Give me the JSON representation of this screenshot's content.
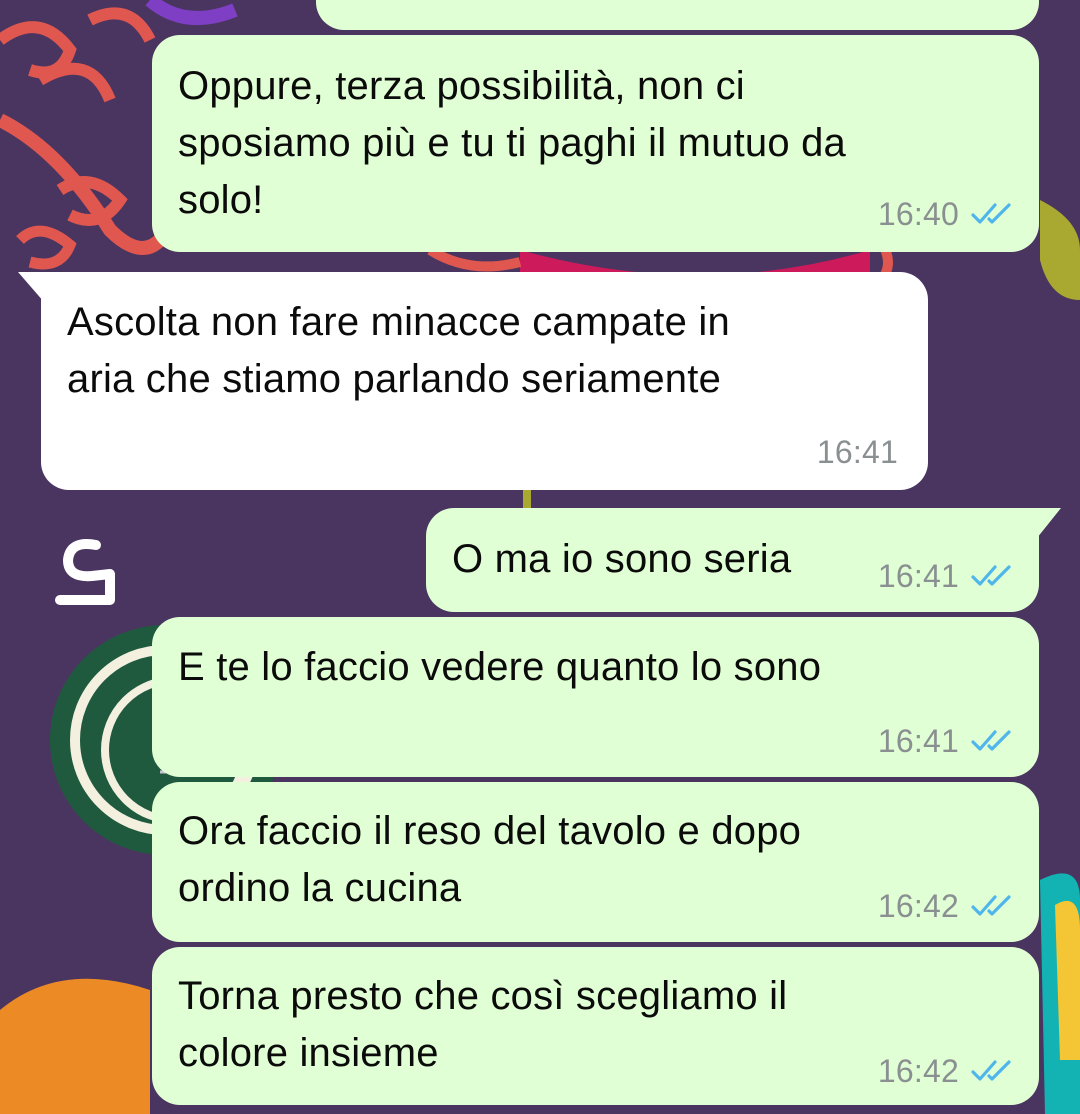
{
  "chat": {
    "colors": {
      "wallpaper": "#4a3560",
      "outgoing_bubble": "#e1ffd4",
      "incoming_bubble": "#ffffff",
      "timestamp": "#8a9091",
      "read_ticks": "#4fb6ec"
    },
    "read_ticks_icon": "double-check-icon",
    "messages": [
      {
        "direction": "outgoing",
        "text": "Oppure, terza possibilità, non ci\nsposiamo più e tu ti paghi il mutuo da\nsolo!",
        "time": "16:40",
        "status": "read"
      },
      {
        "direction": "incoming",
        "text": "Ascolta non fare minacce campate in\naria che stiamo parlando seriamente",
        "time": "16:41"
      },
      {
        "direction": "outgoing",
        "text": "O ma io sono seria",
        "time": "16:41",
        "status": "read"
      },
      {
        "direction": "outgoing",
        "text": "E te lo faccio vedere quanto lo sono",
        "time": "16:41",
        "status": "read"
      },
      {
        "direction": "outgoing",
        "text": "Ora faccio il reso del tavolo e dopo\nordino la cucina",
        "time": "16:42",
        "status": "read"
      },
      {
        "direction": "outgoing",
        "text": "Torna presto che così scegliamo il\ncolore insieme",
        "time": "16:42",
        "status": "read"
      }
    ]
  }
}
